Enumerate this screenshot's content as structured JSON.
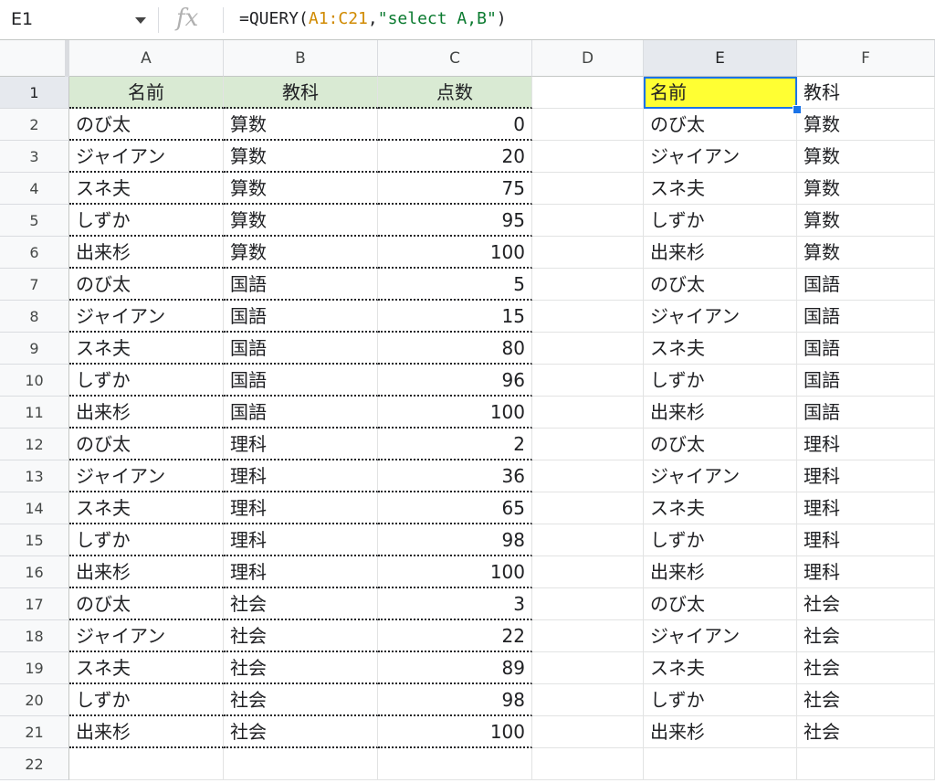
{
  "name_box": {
    "value": "E1"
  },
  "formula_bar": {
    "fx_label": "fx",
    "formula_parts": [
      "=QUERY(",
      "A1:C21",
      ",",
      "\"select A,B\"",
      ")"
    ]
  },
  "column_headers": [
    "A",
    "B",
    "C",
    "D",
    "E",
    "F"
  ],
  "row_headers": [
    "1",
    "2",
    "3",
    "4",
    "5",
    "6",
    "7",
    "8",
    "9",
    "10",
    "11",
    "12",
    "13",
    "14",
    "15",
    "16",
    "17",
    "18",
    "19",
    "20",
    "21",
    "22"
  ],
  "sheet": {
    "header_row": {
      "name": "名前",
      "subject": "教科",
      "score": "点数"
    },
    "rows": [
      {
        "name": "のび太",
        "subject": "算数",
        "score": "0"
      },
      {
        "name": "ジャイアン",
        "subject": "算数",
        "score": "20"
      },
      {
        "name": "スネ夫",
        "subject": "算数",
        "score": "75"
      },
      {
        "name": "しずか",
        "subject": "算数",
        "score": "95"
      },
      {
        "name": "出来杉",
        "subject": "算数",
        "score": "100"
      },
      {
        "name": "のび太",
        "subject": "国語",
        "score": "5"
      },
      {
        "name": "ジャイアン",
        "subject": "国語",
        "score": "15"
      },
      {
        "name": "スネ夫",
        "subject": "国語",
        "score": "80"
      },
      {
        "name": "しずか",
        "subject": "国語",
        "score": "96"
      },
      {
        "name": "出来杉",
        "subject": "国語",
        "score": "100"
      },
      {
        "name": "のび太",
        "subject": "理科",
        "score": "2"
      },
      {
        "name": "ジャイアン",
        "subject": "理科",
        "score": "36"
      },
      {
        "name": "スネ夫",
        "subject": "理科",
        "score": "65"
      },
      {
        "name": "しずか",
        "subject": "理科",
        "score": "98"
      },
      {
        "name": "出来杉",
        "subject": "理科",
        "score": "100"
      },
      {
        "name": "のび太",
        "subject": "社会",
        "score": "3"
      },
      {
        "name": "ジャイアン",
        "subject": "社会",
        "score": "22"
      },
      {
        "name": "スネ夫",
        "subject": "社会",
        "score": "89"
      },
      {
        "name": "しずか",
        "subject": "社会",
        "score": "98"
      },
      {
        "name": "出来杉",
        "subject": "社会",
        "score": "100"
      }
    ],
    "result_header": {
      "name": "名前",
      "subject": "教科"
    }
  },
  "colors": {
    "header_fill": "#d9ead3",
    "active_cell_fill": "#ffff33",
    "selection_border": "#1a73e8"
  }
}
